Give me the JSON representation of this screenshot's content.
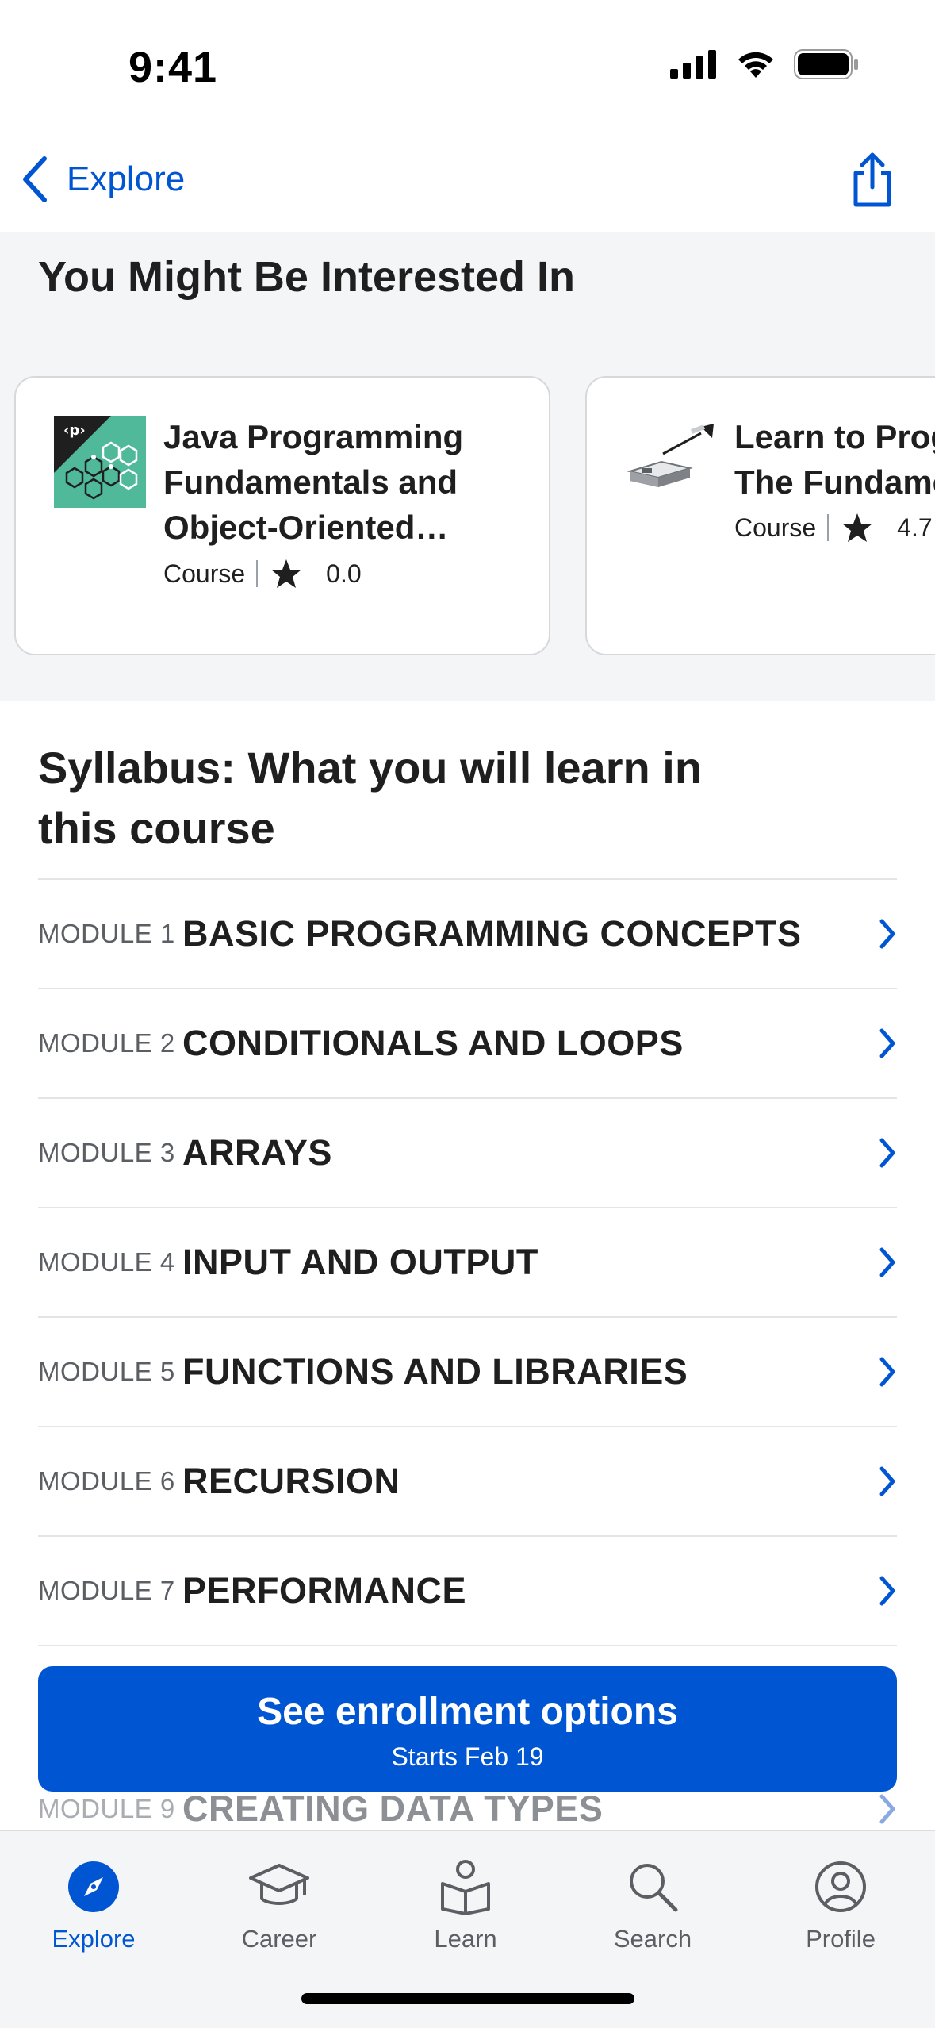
{
  "status_bar": {
    "time": "9:41"
  },
  "nav": {
    "back_label": "Explore"
  },
  "recommendations": {
    "title": "You Might Be Interested In",
    "cards": [
      {
        "title_line1": "Java Programming",
        "title_line2": "Fundamentals and",
        "title_line3": "Object-Oriented…",
        "type": "Course",
        "rating": "0.0"
      },
      {
        "title_line1": "Learn to Prog",
        "title_line2": "The Fundame",
        "type": "Course",
        "rating": "4.7"
      }
    ]
  },
  "syllabus": {
    "title_line1": "Syllabus: What you will learn in",
    "title_line2": "this course",
    "modules": [
      {
        "number": "MODULE 1",
        "name": "BASIC PROGRAMMING CONCEPTS"
      },
      {
        "number": "MODULE 2",
        "name": "CONDITIONALS AND LOOPS"
      },
      {
        "number": "MODULE 3",
        "name": "ARRAYS"
      },
      {
        "number": "MODULE 4",
        "name": "INPUT AND OUTPUT"
      },
      {
        "number": "MODULE 5",
        "name": "FUNCTIONS AND LIBRARIES"
      },
      {
        "number": "MODULE 6",
        "name": "RECURSION"
      },
      {
        "number": "MODULE 7",
        "name": "PERFORMANCE"
      },
      {
        "number": "MODULE 9",
        "name": "CREATING DATA TYPES"
      }
    ]
  },
  "cta": {
    "label": "See enrollment options",
    "sublabel": "Starts Feb 19"
  },
  "tab_bar": {
    "tabs": [
      {
        "label": "Explore",
        "active": true
      },
      {
        "label": "Career"
      },
      {
        "label": "Learn"
      },
      {
        "label": "Search"
      },
      {
        "label": "Profile"
      }
    ]
  },
  "colors": {
    "accent": "#0056d2",
    "section_bg": "#f4f5f7",
    "text": "#1f1f1f",
    "muted": "#5b5e63"
  }
}
